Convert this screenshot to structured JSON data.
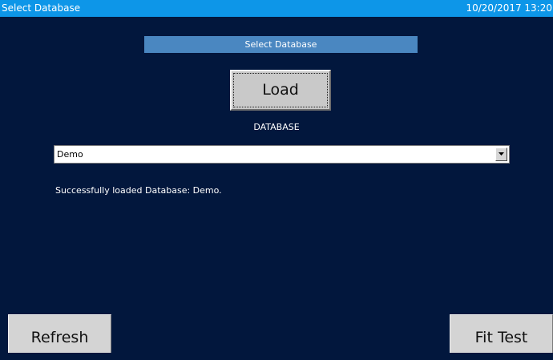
{
  "titlebar": {
    "title": "Select Database",
    "datetime": "10/20/2017 13:20"
  },
  "section": {
    "header": "Select Database"
  },
  "load_button": {
    "label": "Load"
  },
  "database": {
    "label": "DATABASE",
    "selected": "Demo"
  },
  "status": {
    "message": "Successfully loaded Database: Demo."
  },
  "footer": {
    "refresh_label": "Refresh",
    "fit_test_label": "Fit Test"
  },
  "colors": {
    "background": "#02173d",
    "titlebar": "#0d96e8",
    "section_header": "#4a87c1",
    "button_face": "#c9c9c9"
  },
  "icons": {
    "dropdown_arrow": "chevron-down-icon"
  }
}
